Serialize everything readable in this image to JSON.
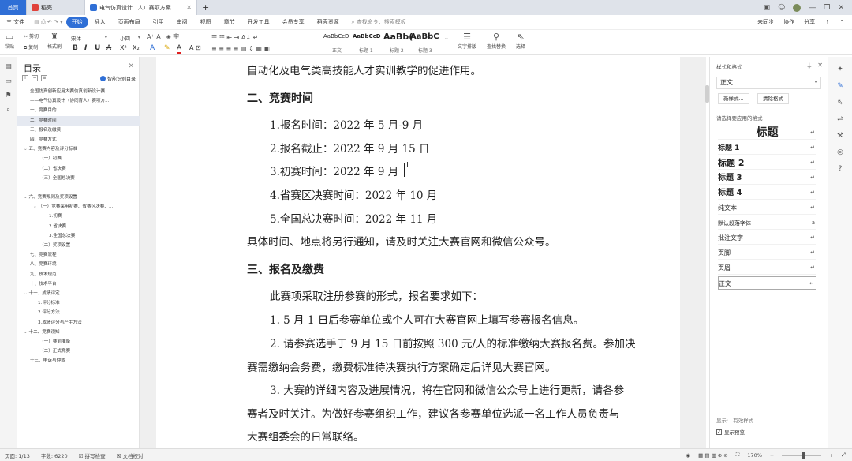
{
  "tabs": [
    {
      "label": "首页"
    },
    {
      "label": "稻壳"
    },
    {
      "label": "电气仿真设计...人）赛项方案"
    }
  ],
  "menu": [
    "三 文件",
    "开始",
    "插入",
    "页面布局",
    "引用",
    "审阅",
    "视图",
    "章节",
    "开发工具",
    "会员专享",
    "稻壳资源"
  ],
  "menu_search": "查找命令、搜索模板",
  "menu_right": [
    "未同步",
    "协作",
    "分享"
  ],
  "toolbar": {
    "paste": "粘贴",
    "cut": "剪切",
    "copy": "复制",
    "format_painter": "格式刷",
    "font": "宋体",
    "size": "小四",
    "styles": [
      {
        "preview": "AaBbCcD",
        "label": "正文"
      },
      {
        "preview": "AaBbCcD",
        "label": "标题 1"
      },
      {
        "preview": "AaBb(",
        "label": "标题 2"
      },
      {
        "preview": "AaBbC",
        "label": "标题 3"
      }
    ],
    "text_layout": "文字排版",
    "find_replace": "查找替换",
    "select": "选择"
  },
  "toc": {
    "title": "目录",
    "smart": "智能识别目录",
    "items": [
      "全国仿真创新应用大赛仿真创新设计赛...",
      "——电气仿真设计（协同育人）赛项方...",
      "一、竞赛目的",
      "二、竞赛时间",
      "三、报名及缴费",
      "四、竞赛方式",
      "五、竞赛内容及评分标准",
      "（一）初赛",
      "（二）省决赛",
      "（三）全国总决赛",
      "",
      "六、竞赛规则及奖项设置",
      "（一）竞赛采用初赛、省赛区决赛、...",
      "1.初赛",
      "2.省决赛",
      "3.全国总决赛",
      "（二）奖项设置",
      "七、竞赛流程",
      "八、竞赛环境",
      "九、技术规范",
      "十、技术平台",
      "十一、成绩评定",
      "1.评分标准",
      "2.评分方法",
      "3.成绩评分与产生方法",
      "十二、竞赛须知",
      "（一）赛前准备",
      "（二）正式竞赛",
      "十三、申诉与仲裁"
    ],
    "selected_index": 3
  },
  "document": {
    "lines": [
      "自动化及电气类高技能人才实训教学的促进作用。",
      "二、竞赛时间",
      "1.报名时间：2022 年 5 月-9 月",
      "2.报名截止：2022 年 9 月 15 日",
      "3.初赛时间：2022 年 9 月",
      "4.省赛区决赛时间：2022 年 10 月",
      "5.全国总决赛时间：2022 年 11 月",
      "具体时间、地点将另行通知，请及时关注大赛官网和微信公众号。",
      "三、报名及缴费",
      "此赛项采取注册参赛的形式，报名要求如下：",
      "1. 5 月 1 日后参赛单位或个人可在大赛官网上填写参赛报名信息。",
      "2. 请参赛选手于 9 月 15 日前按照 300 元/人的标准缴纳大赛报名费。参加决",
      "赛需缴纳会务费，缴费标准待决赛执行方案确定后详见大赛官网。",
      "3. 大赛的详细内容及进展情况，将在官网和微信公众号上进行更新，请各参",
      "赛者及时关注。为做好参赛组织工作，建议各参赛单位选派一名工作人员负责与",
      "大赛组委会的日常联络。"
    ]
  },
  "style_panel": {
    "title": "样式和格式",
    "current": "正文",
    "new_style": "新样式...",
    "clear": "清除格式",
    "hint": "请选择要应用的格式",
    "items": [
      "标题",
      "标题 1",
      "标题 2",
      "标题 3",
      "标题 4",
      "纯文本",
      "默认段落字体",
      "批注文字",
      "页脚",
      "页眉",
      "正文"
    ],
    "show_label": "显示:",
    "show_value": "有效样式",
    "preview": "显示预览"
  },
  "status": {
    "page": "页面: 1/13",
    "words": "字数: 6220",
    "spell": "拼写检查",
    "proof": "文档校对",
    "zoom": "170%"
  }
}
